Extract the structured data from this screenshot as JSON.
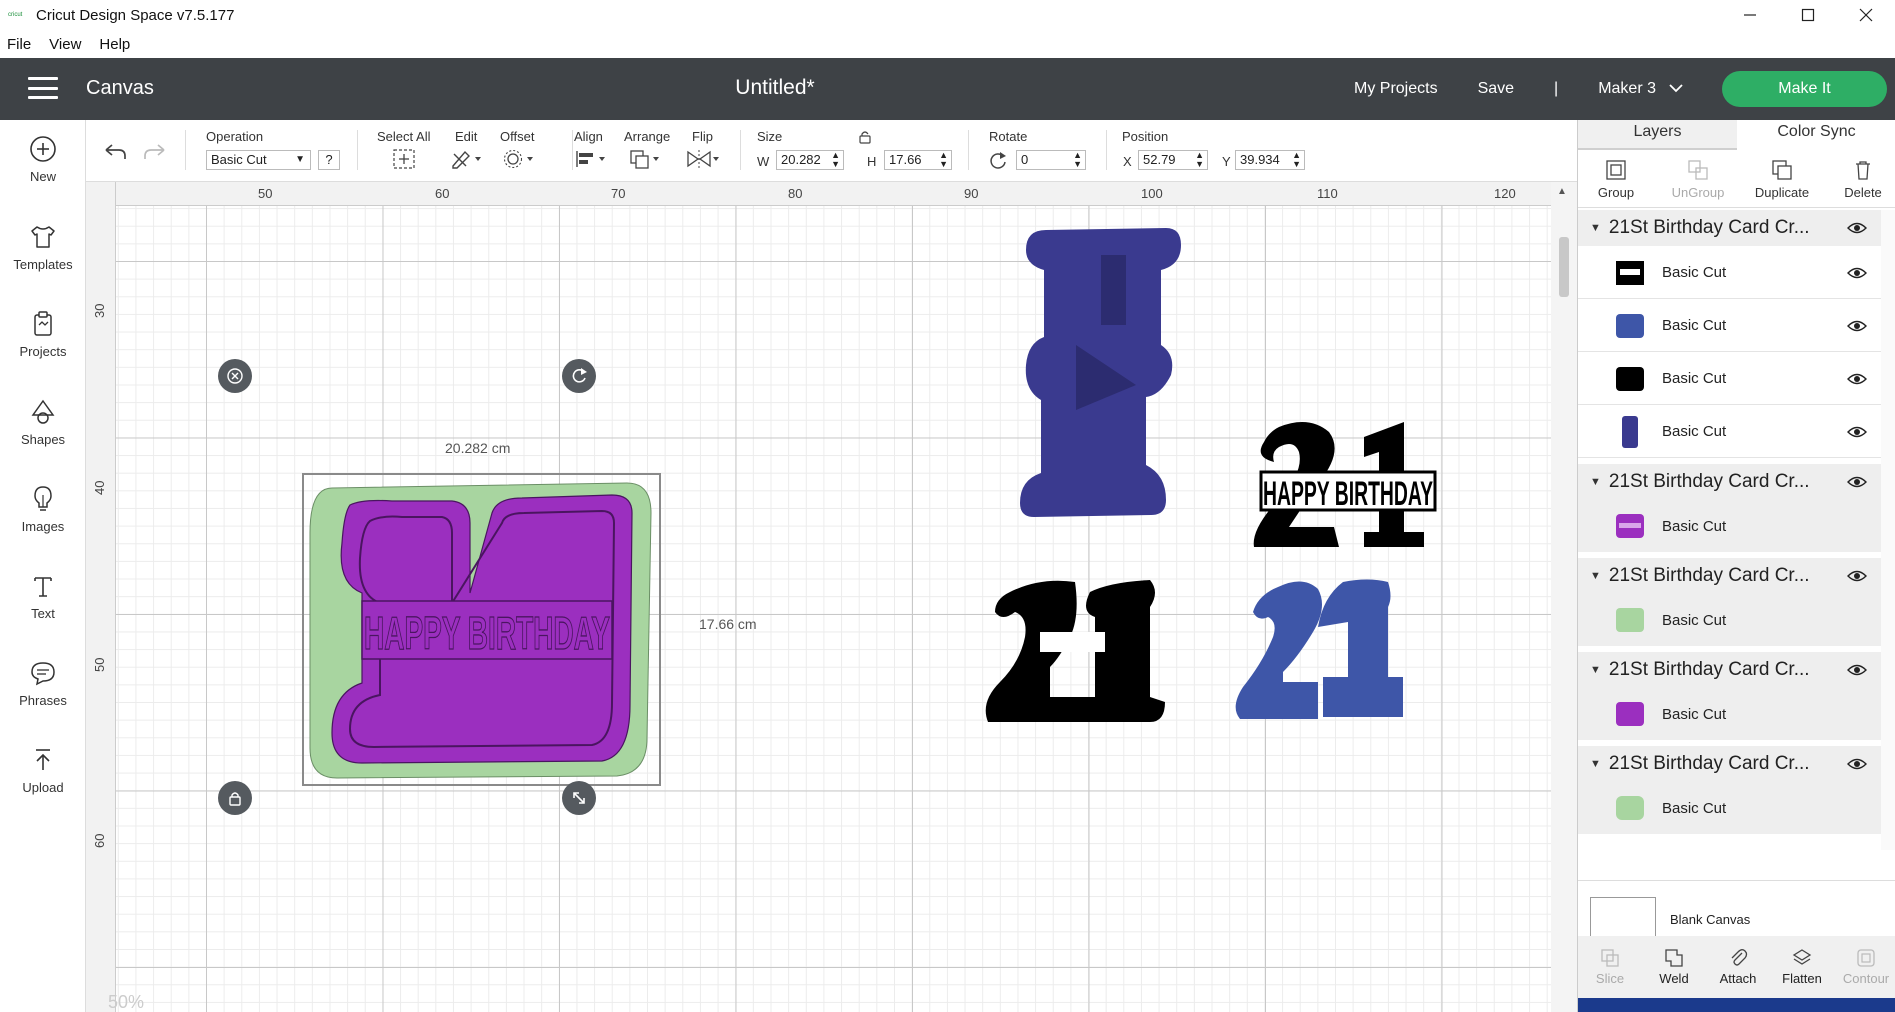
{
  "window": {
    "title": "Cricut Design Space  v7.5.177",
    "logo_text": "cricut"
  },
  "menu": [
    "File",
    "View",
    "Help"
  ],
  "header": {
    "section": "Canvas",
    "title": "Untitled*",
    "my_projects": "My Projects",
    "save": "Save",
    "separator": "|",
    "machine": "Maker 3",
    "make_it": "Make It"
  },
  "sidebar": [
    {
      "label": "New",
      "icon": "plus-circle-icon"
    },
    {
      "label": "Templates",
      "icon": "shirt-icon"
    },
    {
      "label": "Projects",
      "icon": "clipboard-icon"
    },
    {
      "label": "Shapes",
      "icon": "shapes-icon"
    },
    {
      "label": "Images",
      "icon": "lightbulb-icon"
    },
    {
      "label": "Text",
      "icon": "text-t-icon"
    },
    {
      "label": "Phrases",
      "icon": "speech-bubble-icon"
    },
    {
      "label": "Upload",
      "icon": "upload-icon"
    }
  ],
  "toolbar": {
    "operation_label": "Operation",
    "operation_value": "Basic Cut",
    "help": "?",
    "select_all": "Select All",
    "edit": "Edit",
    "offset": "Offset",
    "align": "Align",
    "arrange": "Arrange",
    "flip": "Flip",
    "size_label": "Size",
    "w_label": "W",
    "w_value": "20.282",
    "h_label": "H",
    "h_value": "17.66",
    "rotate_label": "Rotate",
    "rotate_value": "0",
    "position_label": "Position",
    "x_label": "X",
    "x_value": "52.79",
    "y_label": "Y",
    "y_value": "39.934"
  },
  "canvas": {
    "ruler_h": [
      "50",
      "60",
      "70",
      "80",
      "90",
      "100",
      "110",
      "120"
    ],
    "ruler_v": [
      "30",
      "40",
      "50",
      "60"
    ],
    "width_dim": "20.282 cm",
    "height_dim": "17.66 cm",
    "zoom_hint": "50%",
    "artwork_text": "HAPPY BIRTHDAY",
    "artwork_number": "21",
    "colors": {
      "purple": "#9b2fbf",
      "green": "#a8d5a0",
      "navy": "#3a3a8f",
      "blue": "#3e56a8",
      "black": "#000000"
    }
  },
  "panel": {
    "tabs": [
      "Layers",
      "Color Sync"
    ],
    "actions": [
      {
        "label": "Group",
        "enabled": true
      },
      {
        "label": "UnGroup",
        "enabled": false
      },
      {
        "label": "Duplicate",
        "enabled": true
      },
      {
        "label": "Delete",
        "enabled": true
      }
    ],
    "groups": [
      {
        "name": "21St Birthday Card Cr...",
        "layers": [
          "Basic Cut",
          "Basic Cut",
          "Basic Cut",
          "Basic Cut"
        ]
      },
      {
        "name": "21St Birthday Card Cr...",
        "layers": [
          "Basic Cut"
        ]
      },
      {
        "name": "21St Birthday Card Cr...",
        "layers": [
          "Basic Cut"
        ]
      },
      {
        "name": "21St Birthday Card Cr...",
        "layers": [
          "Basic Cut"
        ]
      },
      {
        "name": "21St Birthday Card Cr...",
        "layers": [
          "Basic Cut"
        ]
      }
    ],
    "blank_canvas": "Blank Canvas",
    "bottom_actions": [
      {
        "label": "Slice",
        "enabled": false
      },
      {
        "label": "Weld",
        "enabled": true
      },
      {
        "label": "Attach",
        "enabled": true
      },
      {
        "label": "Flatten",
        "enabled": true
      },
      {
        "label": "Contour",
        "enabled": false
      }
    ]
  }
}
